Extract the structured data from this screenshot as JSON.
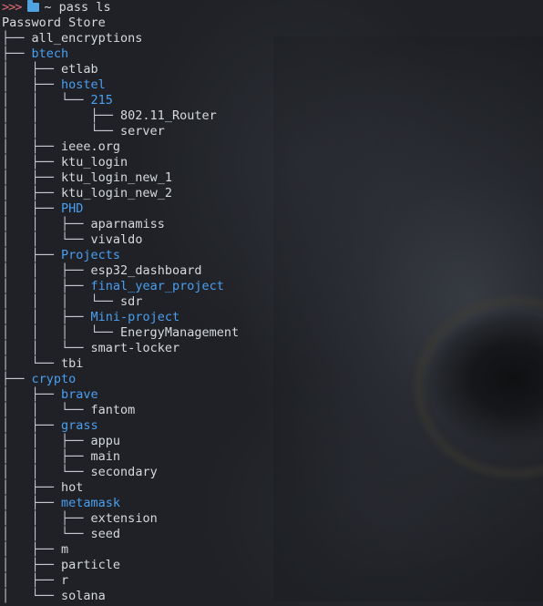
{
  "prompt": {
    "chevrons": ">>>",
    "folder_icon": "folder-icon",
    "path": "~",
    "command": "pass ls"
  },
  "header": "Password Store",
  "colors": {
    "directory": "#4a9ff0",
    "file": "#d6d9de",
    "prompt_chevrons": "#e06c75",
    "background": "#1f2126"
  },
  "tree": [
    {
      "prefix": "├── ",
      "name": "all_encryptions",
      "type": "file"
    },
    {
      "prefix": "├── ",
      "name": "btech",
      "type": "dir"
    },
    {
      "prefix": "│   ├── ",
      "name": "etlab",
      "type": "file"
    },
    {
      "prefix": "│   ├── ",
      "name": "hostel",
      "type": "dir"
    },
    {
      "prefix": "│   │   └── ",
      "name": "215",
      "type": "dir"
    },
    {
      "prefix": "│   │       ├── ",
      "name": "802.11_Router",
      "type": "file"
    },
    {
      "prefix": "│   │       └── ",
      "name": "server",
      "type": "file"
    },
    {
      "prefix": "│   ├── ",
      "name": "ieee.org",
      "type": "file"
    },
    {
      "prefix": "│   ├── ",
      "name": "ktu_login",
      "type": "file"
    },
    {
      "prefix": "│   ├── ",
      "name": "ktu_login_new_1",
      "type": "file"
    },
    {
      "prefix": "│   ├── ",
      "name": "ktu_login_new_2",
      "type": "file"
    },
    {
      "prefix": "│   ├── ",
      "name": "PHD",
      "type": "dir"
    },
    {
      "prefix": "│   │   ├── ",
      "name": "aparnamiss",
      "type": "file"
    },
    {
      "prefix": "│   │   └── ",
      "name": "vivaldo",
      "type": "file"
    },
    {
      "prefix": "│   ├── ",
      "name": "Projects",
      "type": "dir"
    },
    {
      "prefix": "│   │   ├── ",
      "name": "esp32_dashboard",
      "type": "file"
    },
    {
      "prefix": "│   │   ├── ",
      "name": "final_year_project",
      "type": "dir"
    },
    {
      "prefix": "│   │   │   └── ",
      "name": "sdr",
      "type": "file"
    },
    {
      "prefix": "│   │   ├── ",
      "name": "Mini-project",
      "type": "dir"
    },
    {
      "prefix": "│   │   │   └── ",
      "name": "EnergyManagement",
      "type": "file"
    },
    {
      "prefix": "│   │   └── ",
      "name": "smart-locker",
      "type": "file"
    },
    {
      "prefix": "│   └── ",
      "name": "tbi",
      "type": "file"
    },
    {
      "prefix": "├── ",
      "name": "crypto",
      "type": "dir"
    },
    {
      "prefix": "│   ├── ",
      "name": "brave",
      "type": "dir"
    },
    {
      "prefix": "│   │   └── ",
      "name": "fantom",
      "type": "file"
    },
    {
      "prefix": "│   ├── ",
      "name": "grass",
      "type": "dir"
    },
    {
      "prefix": "│   │   ├── ",
      "name": "appu",
      "type": "file"
    },
    {
      "prefix": "│   │   ├── ",
      "name": "main",
      "type": "file"
    },
    {
      "prefix": "│   │   └── ",
      "name": "secondary",
      "type": "file"
    },
    {
      "prefix": "│   ├── ",
      "name": "hot",
      "type": "file"
    },
    {
      "prefix": "│   ├── ",
      "name": "metamask",
      "type": "dir"
    },
    {
      "prefix": "│   │   ├── ",
      "name": "extension",
      "type": "file"
    },
    {
      "prefix": "│   │   └── ",
      "name": "seed",
      "type": "file"
    },
    {
      "prefix": "│   ├── ",
      "name": "m",
      "type": "file"
    },
    {
      "prefix": "│   ├── ",
      "name": "particle",
      "type": "file"
    },
    {
      "prefix": "│   ├── ",
      "name": "r",
      "type": "file"
    },
    {
      "prefix": "│   └── ",
      "name": "solana",
      "type": "file"
    }
  ]
}
